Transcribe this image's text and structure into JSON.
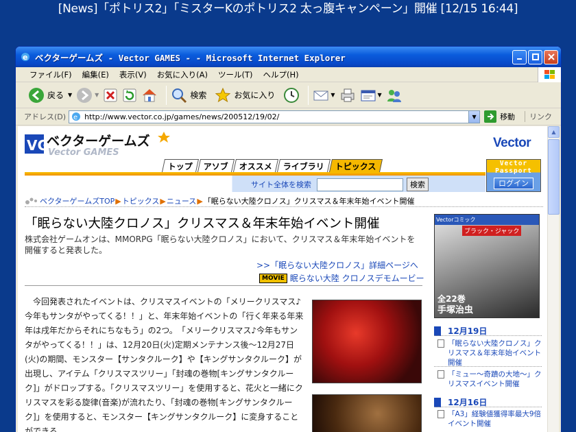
{
  "caption": "[News]「ポトリス2」「ミスターKのポトリス2 太っ腹キャンペーン」開催 [12/15 16:44]",
  "window": {
    "title": "ベクターゲームズ - Vector GAMES - - Microsoft Internet Explorer"
  },
  "menu": [
    "ファイル(F)",
    "編集(E)",
    "表示(V)",
    "お気に入り(A)",
    "ツール(T)",
    "ヘルプ(H)"
  ],
  "toolbar": {
    "back": "戻る",
    "search": "検索",
    "favorites": "お気に入り"
  },
  "address": {
    "label": "アドレス(D)",
    "url": "http://www.vector.co.jp/games/news/200512/19/02/",
    "go": "移動",
    "links": "リンク"
  },
  "site": {
    "logo_text": "ベクターゲームズ",
    "logo_sub": "Vector GAMES",
    "vector_logo": "Vector",
    "tabs": [
      "トップ",
      "アソブ",
      "オススメ",
      "ライブラリ",
      "トピックス"
    ],
    "passport_line1": "Vector",
    "passport_line2": "Passport",
    "login": "ログイン",
    "search_label": "サイト全体を検索",
    "search_button": "検索"
  },
  "breadcrumb": {
    "top": "ベクターゲームズTOP",
    "topics": "トピックス",
    "news": "ニュース",
    "current": "「眠らない大陸クロノス」クリスマス＆年末年始イベント開催"
  },
  "article": {
    "title": "「眠らない大陸クロノス」クリスマス＆年末年始イベント開催",
    "lead": "株式会社ゲームオンは、MMORPG「眠らない大陸クロノス」において、クリスマス＆年末年始イベントを開催すると発表した。",
    "detail_link": ">>「眠らない大陸クロノス」詳細ページへ",
    "movie_badge": "MOVIE",
    "movie_link": "眠らない大陸 クロノスデモムービー",
    "body": "　今回発表されたイベントは、クリスマスイベントの「メリークリスマス♪今年もサンタがやってくる！！」と、年末年始イベントの「行く年来る年来年は戌年だからそれにちなもう」の2つ。　「メリークリスマス♪今年もサンタがやってくる！！」は、12月20日(火)定期メンテナンス後〜12月27日(火)の期間、モンスター【サンタクルーク】や【キングサンタクルーク】が出現し、アイテム「クリスマスツリー」「封魂の巻物[キングサンタクルーク]」がドロップする。「クリスマスツリー」を使用すると、花火と一緒にクリスマスを彩る旋律(音楽)が流れたり、「封魂の巻物[キングサンタクルーク]」を使用すると、モンスター【キングサンタクルーク】に変身することができる。"
  },
  "ad": {
    "top": "Vectorコミック",
    "title": "ブラック・ジャック",
    "count": "全22巻",
    "author": "手塚治虫"
  },
  "sidebar": {
    "date1": "12月19日",
    "item1": "「眠らない大陸クロノス」クリスマス＆年末年始イベント開催",
    "item2": "「ミュー〜奇蹟の大地〜」クリスマスイベント開催",
    "date2": "12月16日",
    "item3": "「A3」経験値獲得率最大9倍イベント開催"
  }
}
